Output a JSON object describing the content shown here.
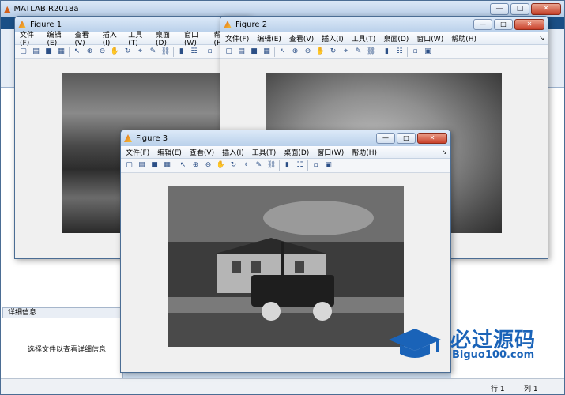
{
  "main_window": {
    "title": "MATLAB R2018a",
    "details_header": "详细信息",
    "details_text": "选择文件以查看详细信息",
    "status": {
      "row_label": "行",
      "row_value": "1",
      "col_label": "列",
      "col_value": "1"
    }
  },
  "menu": [
    "文件(F)",
    "编辑(E)",
    "查看(V)",
    "插入(I)",
    "工具(T)",
    "桌面(D)",
    "窗口(W)",
    "帮助(H)"
  ],
  "toolbar_icons": [
    "new-figure-icon",
    "open-icon",
    "save-icon",
    "print-icon",
    "pointer-icon",
    "zoom-in-icon",
    "zoom-out-icon",
    "pan-icon",
    "rotate-icon",
    "data-cursor-icon",
    "brush-icon",
    "link-icon",
    "colorbar-icon",
    "legend-icon",
    "hide-tools-icon",
    "show-tools-icon"
  ],
  "figures": [
    {
      "title": "Figure 1"
    },
    {
      "title": "Figure 2"
    },
    {
      "title": "Figure 3"
    }
  ],
  "window_buttons": {
    "minimize": "—",
    "maximize": "□",
    "close": "✕"
  },
  "watermark": {
    "text": "必过源码",
    "domain": "Biguo100.com"
  },
  "colors": {
    "accent": "#1a63b8",
    "titlebar": "#b9d0ea"
  }
}
